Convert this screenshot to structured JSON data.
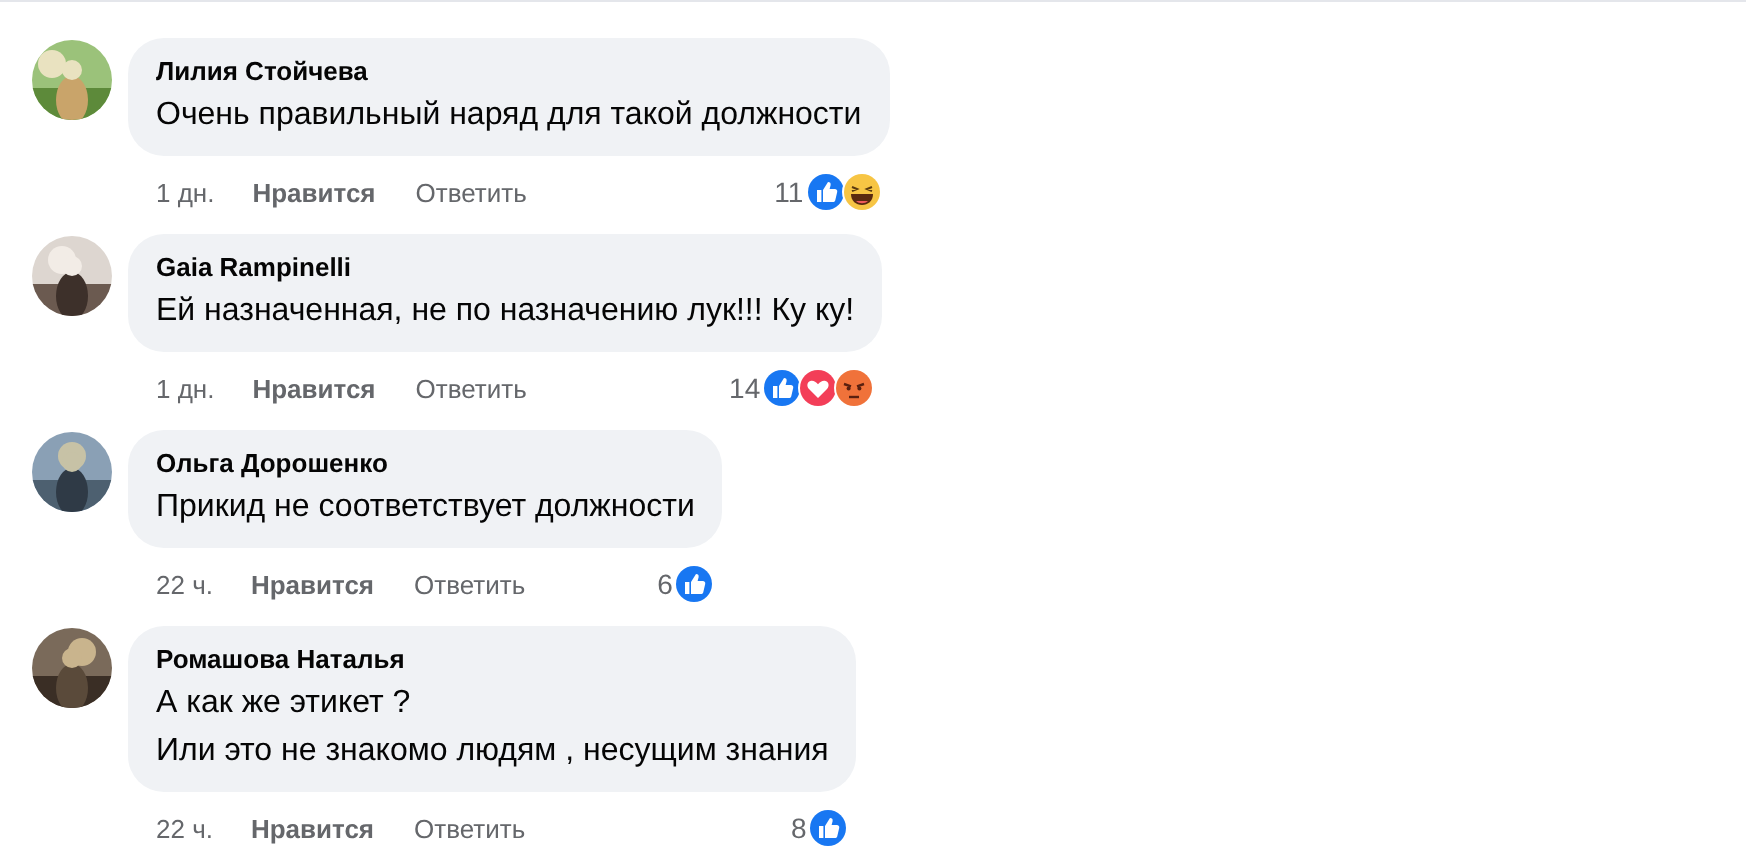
{
  "comments": [
    {
      "author": "Лилия Стойчева",
      "lines": [
        "Очень правильный наряд для такой должности"
      ],
      "time": "1 дн.",
      "like": "Нравится",
      "reply": "Ответить",
      "count": "11",
      "reactions": [
        {
          "kind": "like"
        },
        {
          "kind": "haha"
        }
      ]
    },
    {
      "author": "Gaia Rampinelli",
      "lines": [
        "Ей назначенная, не по назначению лук!!! Ку ку!"
      ],
      "time": "1 дн.",
      "like": "Нравится",
      "reply": "Ответить",
      "count": "14",
      "reactions": [
        {
          "kind": "like"
        },
        {
          "kind": "love"
        },
        {
          "kind": "angry"
        }
      ]
    },
    {
      "author": "Ольга Дорошенко",
      "lines": [
        "Прикид не соответствует должности"
      ],
      "time": "22 ч.",
      "like": "Нравится",
      "reply": "Ответить",
      "count": "6",
      "reactions": [
        {
          "kind": "like"
        }
      ]
    },
    {
      "author": "Ромашова Наталья",
      "lines": [
        "А как же этикет ?",
        "Или это не знакомо людям , несущим знания"
      ],
      "time": "22 ч.",
      "like": "Нравится",
      "reply": "Ответить",
      "count": "8",
      "reactions": [
        {
          "kind": "like"
        }
      ]
    }
  ]
}
